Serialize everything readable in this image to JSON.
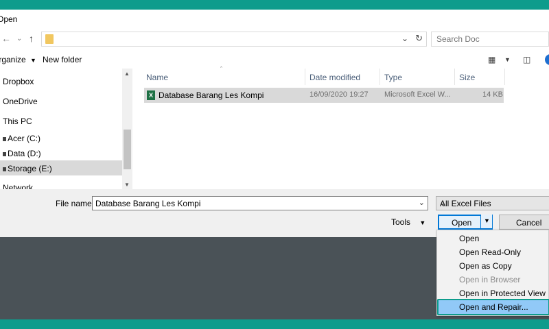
{
  "window": {
    "title": "Open"
  },
  "address_bar": {
    "path": "",
    "search_placeholder": "Search Doc"
  },
  "toolbar": {
    "organize_label": "Organize",
    "new_folder_label": "New folder"
  },
  "nav_pane": {
    "items": [
      {
        "label": "Dropbox"
      },
      {
        "label": "OneDrive"
      },
      {
        "label": "This PC"
      },
      {
        "label": "Acer (C:)"
      },
      {
        "label": "Data (D:)"
      },
      {
        "label": "Storage (E:)",
        "selected": true
      },
      {
        "label": "Network"
      }
    ]
  },
  "file_list": {
    "columns": [
      "Name",
      "Date modified",
      "Type",
      "Size"
    ],
    "rows": [
      {
        "name": "Database Barang Les Kompi",
        "date_modified": "16/09/2020 19:27",
        "type": "Microsoft Excel W...",
        "size": "14 KB",
        "selected": true
      }
    ]
  },
  "footer": {
    "file_name_label": "File name:",
    "file_name_value": "Database Barang Les Kompi",
    "file_type_filter": "All Excel Files",
    "tools_label": "Tools",
    "open_label": "Open",
    "cancel_label": "Cancel"
  },
  "open_menu": {
    "items": [
      {
        "label": "Open",
        "enabled": true
      },
      {
        "label": "Open Read-Only",
        "enabled": true
      },
      {
        "label": "Open as Copy",
        "enabled": true
      },
      {
        "label": "Open in Browser",
        "enabled": false
      },
      {
        "label": "Open in Protected View",
        "enabled": true
      },
      {
        "label": "Open and Repair...",
        "enabled": true,
        "highlighted": true
      }
    ]
  },
  "colors": {
    "frame_accent": "#0e9c8c",
    "background": "#4a5257",
    "menu_highlight": "#91c9f7"
  }
}
